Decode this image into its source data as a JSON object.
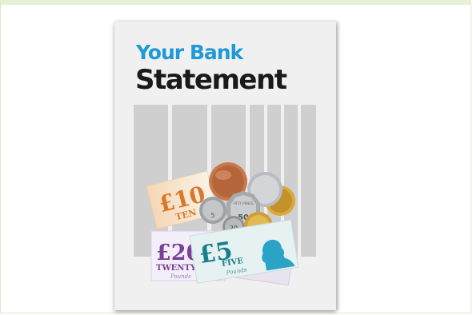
{
  "cover": {
    "title_line1": "Your Bank",
    "title_line2": "Statement"
  },
  "notes": {
    "ten_value": "£10",
    "ten_word": "TEN",
    "twenty_value": "£20",
    "twenty_word": "TWENTY",
    "twenty_script": "Pounds",
    "five_value": "£5",
    "five_word": "FIVE",
    "five_script": "Pounds"
  },
  "coins": {
    "coin_5": "5",
    "coin_50": "50",
    "coin_20": "20",
    "coin_1": "£1",
    "coin_fifty_text": "FIFTY PENCE"
  },
  "colors": {
    "title_blue": "#1f9ad6",
    "title_dark": "#1a1a1a",
    "column_gray": "#cfcfcf",
    "note_ten": "#e58a3c",
    "note_twenty": "#7a3f97",
    "note_five": "#1a7f8c"
  }
}
